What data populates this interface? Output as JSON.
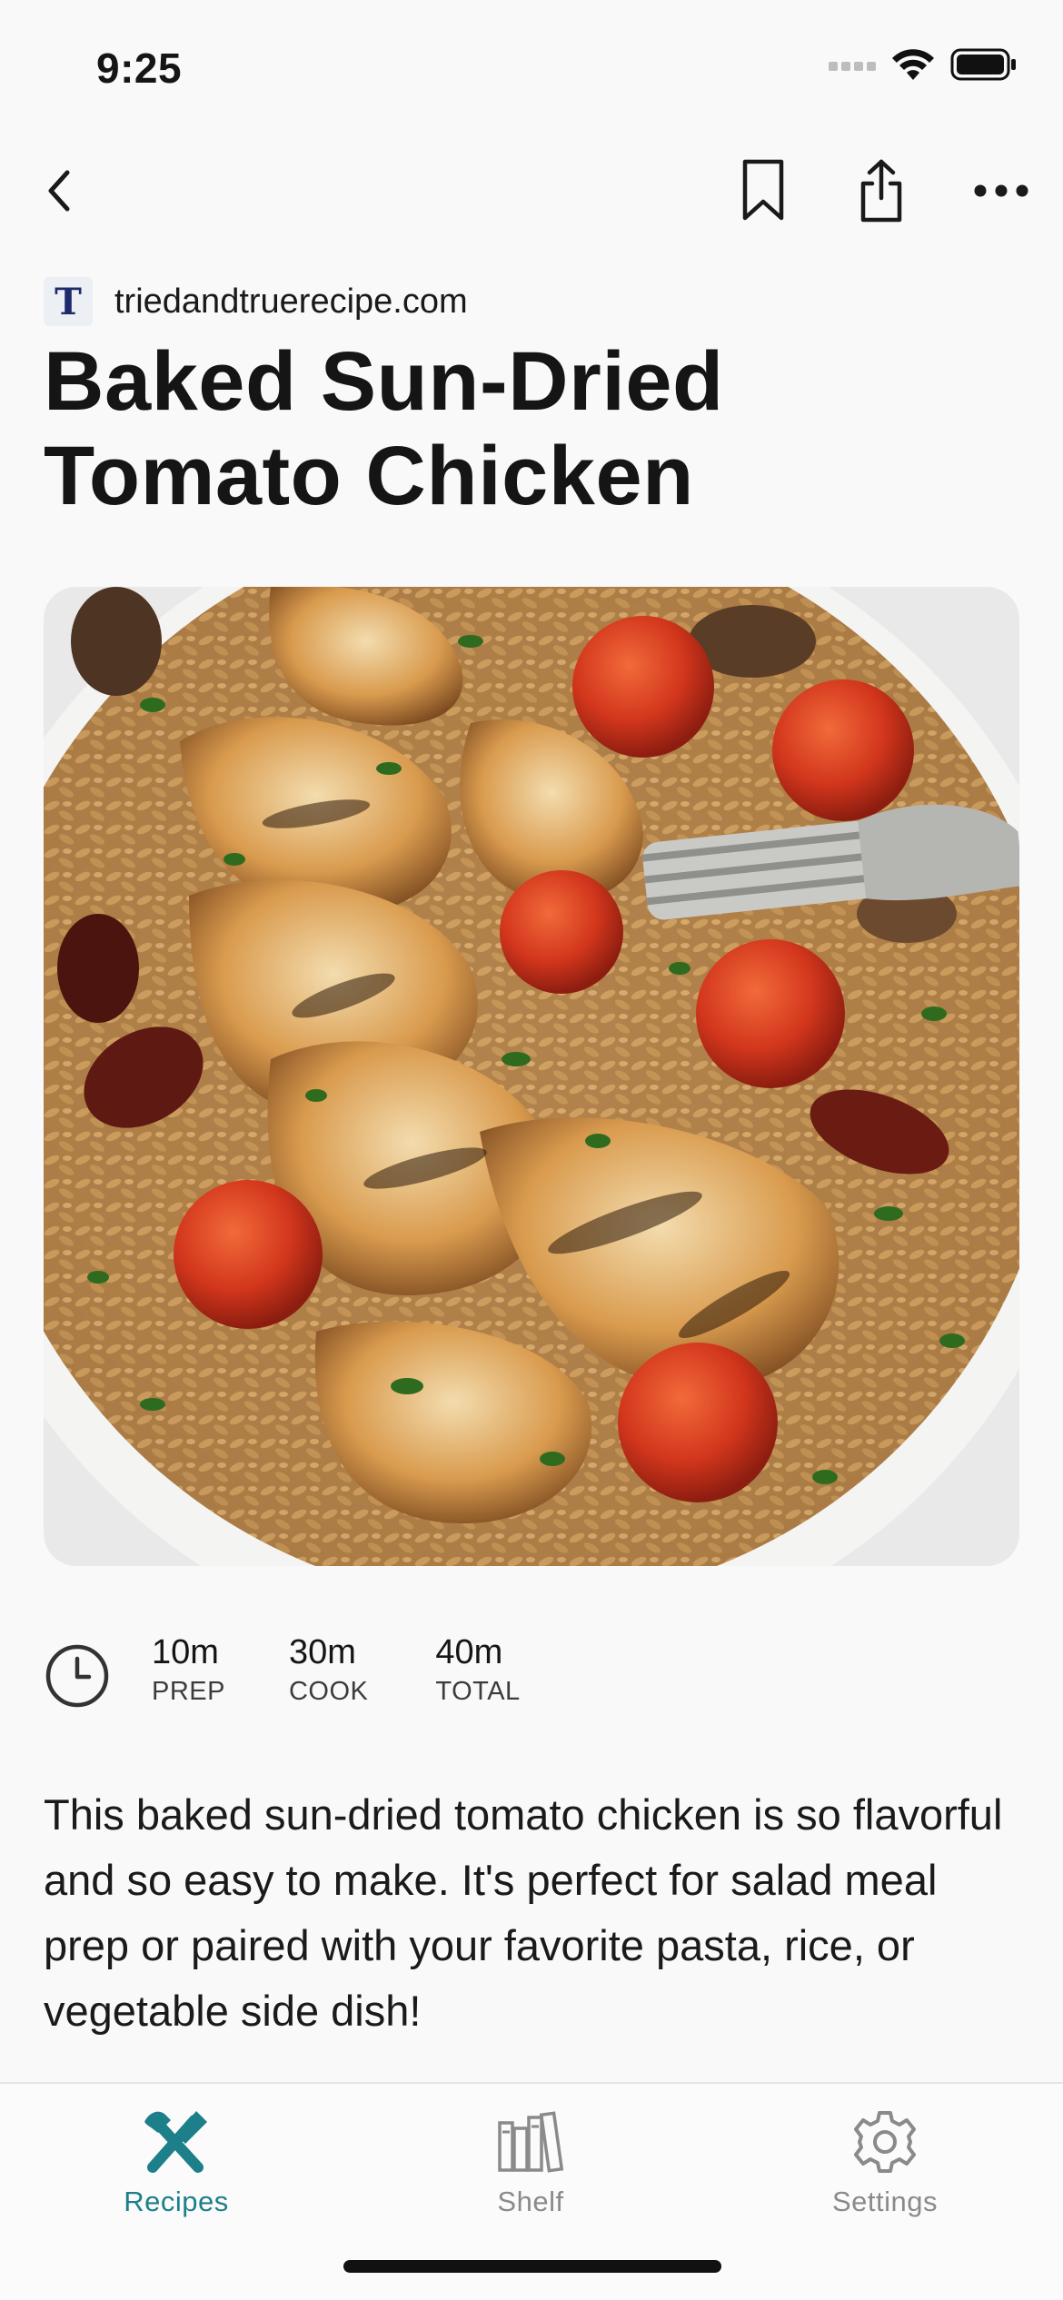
{
  "status_bar": {
    "time": "9:25"
  },
  "nav": {
    "back_icon": "chevron-left-icon",
    "bookmark_icon": "bookmark-icon",
    "share_icon": "share-icon",
    "more_icon": "ellipsis-icon"
  },
  "source": {
    "logo_letter": "T",
    "domain": "triedandtruerecipe.com"
  },
  "recipe": {
    "title_line1": "Baked Sun-Dried",
    "title_line2": "Tomato Chicken",
    "times": [
      {
        "value": "10m",
        "label": "PREP"
      },
      {
        "value": "30m",
        "label": "COOK"
      },
      {
        "value": "40m",
        "label": "TOTAL"
      }
    ],
    "description": "This baked sun-dried tomato chicken is so flavorful and so easy to make. It's perfect for salad meal prep or paired with your favorite pasta, rice, or vegetable side dish!"
  },
  "tab_bar": {
    "active_color": "#1d7f89",
    "inactive_color": "#8a8a8a",
    "tabs": [
      {
        "label": "Recipes",
        "icon": "fork-knife-icon",
        "active": true
      },
      {
        "label": "Shelf",
        "icon": "books-icon",
        "active": false
      },
      {
        "label": "Settings",
        "icon": "gear-icon",
        "active": false
      }
    ]
  }
}
